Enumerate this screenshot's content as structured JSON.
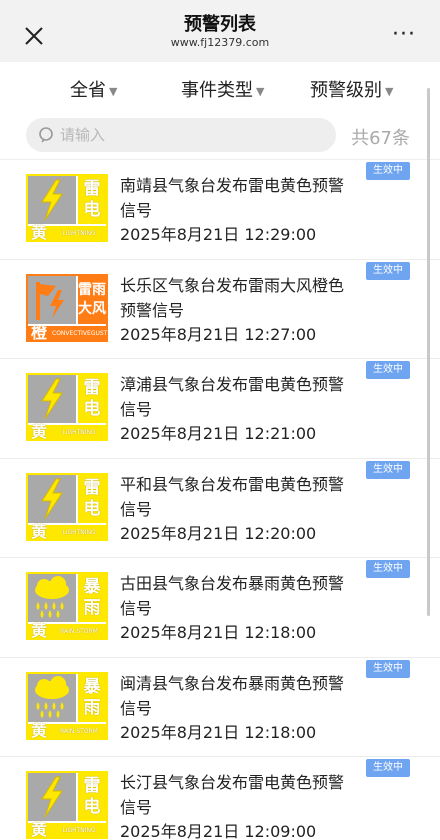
{
  "header": {
    "title": "预警列表",
    "subtitle": "www.fj12379.com",
    "more_label": "···"
  },
  "filters": {
    "province": "全省",
    "event_type": "事件类型",
    "level": "预警级别"
  },
  "search": {
    "placeholder": "请输入",
    "value": "",
    "count_label": "共67条"
  },
  "colors": {
    "yellow": "#ffe800",
    "orange": "#ff7d14",
    "badge": "#6ea4f0"
  },
  "warnings": [
    {
      "title": "南靖县气象台发布雷电黄色预警信号",
      "time": "2025年8月21日 12:29:00",
      "badge": "生效中",
      "signal": {
        "color": "yellow",
        "icon": "lightning-icon",
        "kw1": "雷",
        "kw2": "电",
        "level": "黄",
        "en": "LIGHTNING"
      }
    },
    {
      "title": "长乐区气象台发布雷雨大风橙色预警信号",
      "time": "2025年8月21日 12:27:00",
      "badge": "生效中",
      "signal": {
        "color": "orange",
        "icon": "lightning-wind-icon",
        "kw1": "雷雨",
        "kw2": "大风",
        "level": "橙",
        "en": "CONVECTIVEGUST"
      }
    },
    {
      "title": "漳浦县气象台发布雷电黄色预警信号",
      "time": "2025年8月21日 12:21:00",
      "badge": "生效中",
      "signal": {
        "color": "yellow",
        "icon": "lightning-icon",
        "kw1": "雷",
        "kw2": "电",
        "level": "黄",
        "en": "LIGHTNING"
      }
    },
    {
      "title": "平和县气象台发布雷电黄色预警信号",
      "time": "2025年8月21日 12:20:00",
      "badge": "生效中",
      "signal": {
        "color": "yellow",
        "icon": "lightning-icon",
        "kw1": "雷",
        "kw2": "电",
        "level": "黄",
        "en": "LIGHTNING"
      }
    },
    {
      "title": "古田县气象台发布暴雨黄色预警信号",
      "time": "2025年8月21日 12:18:00",
      "badge": "生效中",
      "signal": {
        "color": "yellow",
        "icon": "rainstorm-icon",
        "kw1": "暴",
        "kw2": "雨",
        "level": "黄",
        "en": "RAIN STORM"
      }
    },
    {
      "title": "闽清县气象台发布暴雨黄色预警信号",
      "time": "2025年8月21日 12:18:00",
      "badge": "生效中",
      "signal": {
        "color": "yellow",
        "icon": "rainstorm-icon",
        "kw1": "暴",
        "kw2": "雨",
        "level": "黄",
        "en": "RAIN STORM"
      }
    },
    {
      "title": "长汀县气象台发布雷电黄色预警信号",
      "time": "2025年8月21日 12:09:00",
      "badge": "生效中",
      "signal": {
        "color": "yellow",
        "icon": "lightning-icon",
        "kw1": "雷",
        "kw2": "电",
        "level": "黄",
        "en": "LIGHTNING"
      }
    }
  ]
}
